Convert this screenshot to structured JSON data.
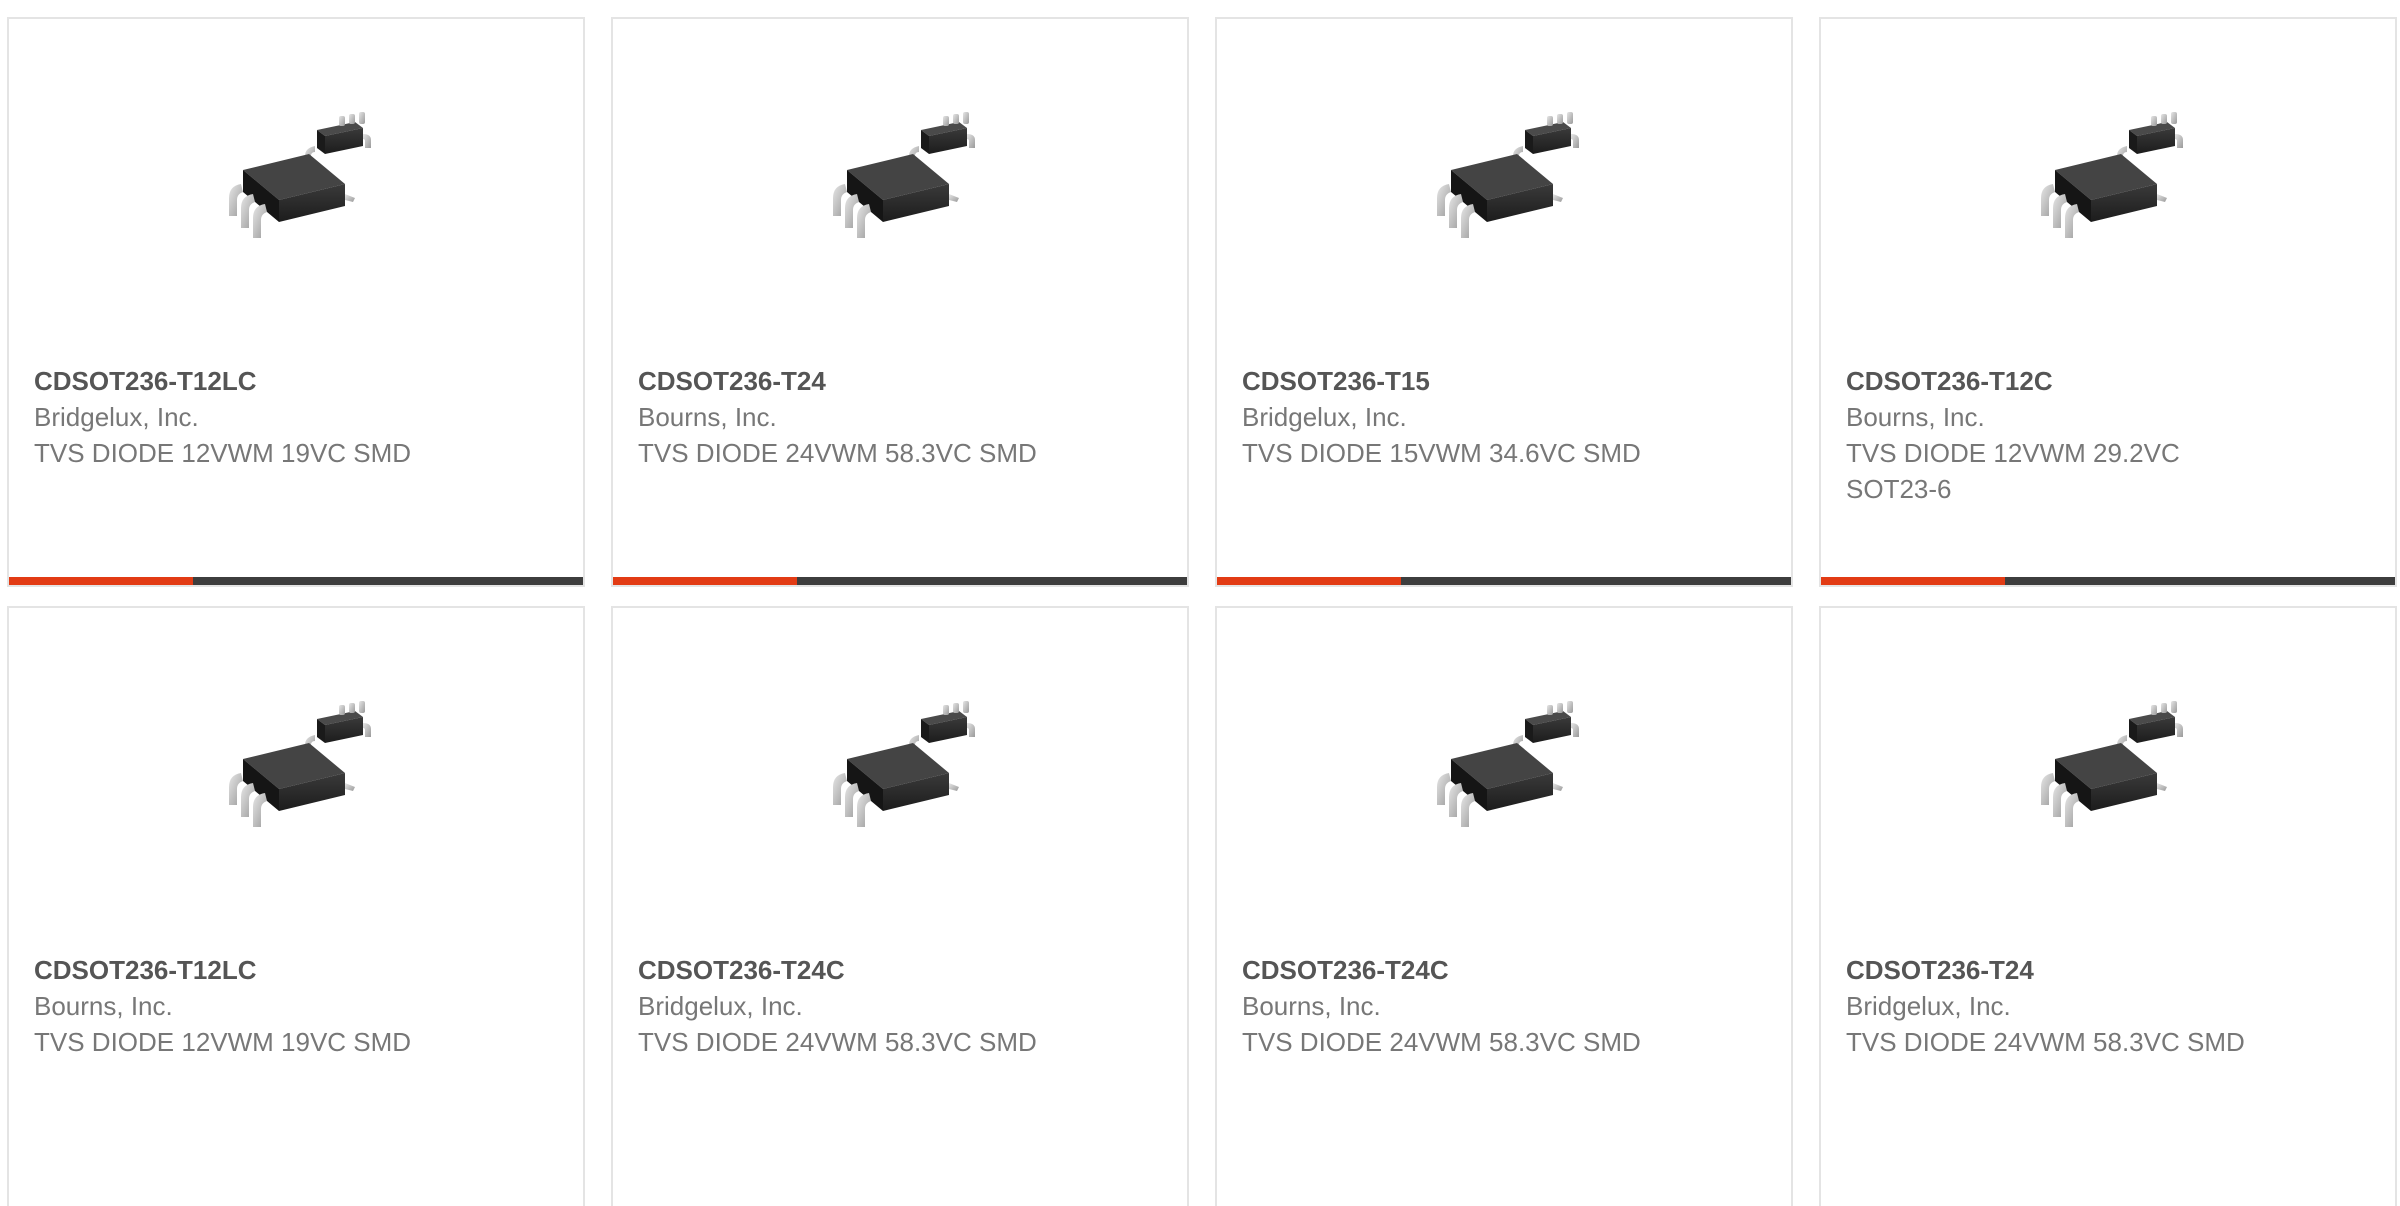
{
  "colors": {
    "accent": "#e23b14",
    "track": "#3d3d3d",
    "title": "#555555",
    "text": "#777777",
    "border": "#e4e4e4"
  },
  "products": [
    {
      "part_number": "CDSOT236-T12LC",
      "manufacturer": "Bridgelux, Inc.",
      "description": "TVS DIODE 12VWM 19VC SMD",
      "image_icon": "sot23-chip-image",
      "progress": 0.32
    },
    {
      "part_number": "CDSOT236-T24",
      "manufacturer": "Bourns, Inc.",
      "description": "TVS DIODE 24VWM 58.3VC SMD",
      "image_icon": "sot23-chip-image",
      "progress": 0.32
    },
    {
      "part_number": "CDSOT236-T15",
      "manufacturer": "Bridgelux, Inc.",
      "description": "TVS DIODE 15VWM 34.6VC SMD",
      "image_icon": "sot23-chip-image",
      "progress": 0.32
    },
    {
      "part_number": "CDSOT236-T12C",
      "manufacturer": "Bourns, Inc.",
      "description": "TVS DIODE 12VWM 29.2VC SOT23-6",
      "image_icon": "sot23-chip-image",
      "progress": 0.32
    },
    {
      "part_number": "CDSOT236-T12LC",
      "manufacturer": "Bourns, Inc.",
      "description": "TVS DIODE 12VWM 19VC SMD",
      "image_icon": "sot23-chip-image"
    },
    {
      "part_number": "CDSOT236-T24C",
      "manufacturer": "Bridgelux, Inc.",
      "description": "TVS DIODE 24VWM 58.3VC SMD",
      "image_icon": "sot23-chip-image"
    },
    {
      "part_number": "CDSOT236-T24C",
      "manufacturer": "Bourns, Inc.",
      "description": "TVS DIODE 24VWM 58.3VC SMD",
      "image_icon": "sot23-chip-image"
    },
    {
      "part_number": "CDSOT236-T24",
      "manufacturer": "Bridgelux, Inc.",
      "description": "TVS DIODE 24VWM 58.3VC SMD",
      "image_icon": "sot23-chip-image"
    }
  ]
}
